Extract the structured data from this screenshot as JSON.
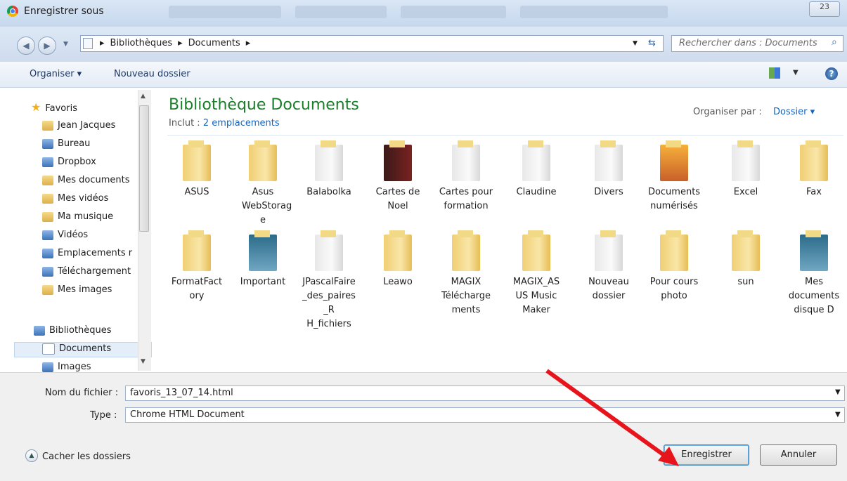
{
  "window": {
    "title": "Enregistrer sous",
    "close_label": "23"
  },
  "address": {
    "crumbs": [
      "Bibliothèques",
      "Documents"
    ],
    "search_placeholder": "Rechercher dans : Documents"
  },
  "toolbar": {
    "organize_label": "Organiser ▾",
    "new_folder_label": "Nouveau dossier"
  },
  "nav": {
    "favorites_label": "Favoris",
    "items": [
      "Jean Jacques",
      "Bureau",
      "Dropbox",
      "Mes documents",
      "Mes vidéos",
      "Ma musique",
      "Vidéos",
      "Emplacements r",
      "Téléchargement",
      "Mes images"
    ],
    "libraries_label": "Bibliothèques",
    "library_items": [
      "Documents",
      "Images"
    ]
  },
  "main": {
    "title": "Bibliothèque Documents",
    "includes_prefix": "Inclut :",
    "includes_link": "2 emplacements",
    "arrange_label": "Organiser par :",
    "arrange_value": "Dossier ▾",
    "folders_row1": [
      "ASUS",
      "Asus WebStorag e",
      "Balabolka",
      "Cartes de Noel",
      "Cartes pour formation",
      "Claudine",
      "Divers",
      "Documents numérisés",
      "Excel",
      "Fax"
    ],
    "folders_row2": [
      "FormatFact ory",
      "Important",
      "JPascalFaire _des_paires _R H_fichiers",
      "Leawo",
      "MAGIX Télécharge ments",
      "MAGIX_AS US Music Maker",
      "Nouveau dossier",
      "Pour cours photo",
      "sun",
      "Mes documents disque D"
    ]
  },
  "form": {
    "filename_label": "Nom du fichier :",
    "filename_value": "favoris_13_07_14.html",
    "type_label": "Type :",
    "type_value": "Chrome HTML Document"
  },
  "footer": {
    "hide_folders_label": "Cacher les dossiers",
    "save_label": "Enregistrer",
    "cancel_label": "Annuler"
  },
  "colors": {
    "accent": "#1565c0",
    "library_title": "#1a7f2a",
    "annotation_arrow": "#e8141b"
  }
}
